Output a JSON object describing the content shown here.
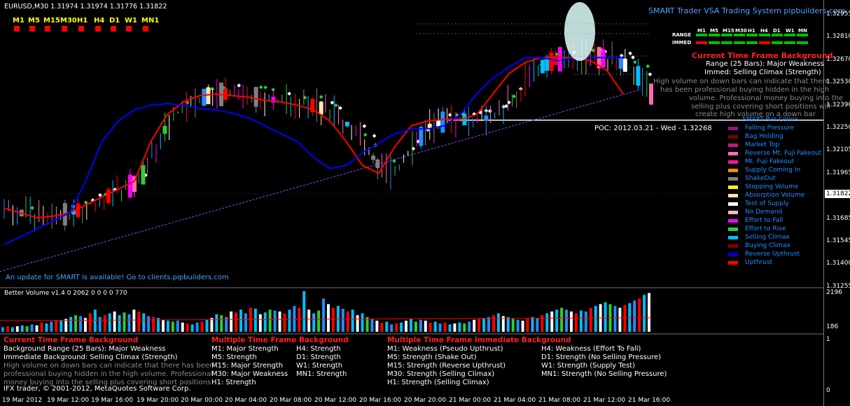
{
  "header": {
    "symbol_line": "EURUSD,M30  1.31974 1.31974 1.31776 1.31822",
    "brand": "SMART Trader VSA Trading System pipbuilders.com"
  },
  "timeframes": [
    "M1",
    "M5",
    "M15",
    "M30",
    "H1",
    "H4",
    "D1",
    "W1",
    "MN1"
  ],
  "mtf_grid": {
    "headers": [
      "M1",
      "M5",
      "M15",
      "M30",
      "H1",
      "H4",
      "D1",
      "W1",
      "MN"
    ],
    "rows": [
      {
        "label": "RANGE",
        "colors": [
          "#00c000",
          "#00c000",
          "#00c000",
          "#00c000",
          "#00c000",
          "#00c000",
          "#00c000",
          "#00c000",
          "#00c000"
        ]
      },
      {
        "label": "IMMED",
        "colors": [
          "#ff0000",
          "#00c000",
          "#00c000",
          "#00c000",
          "#00c000",
          "#ff0000",
          "#00c000",
          "#00c000",
          "#00c000"
        ]
      }
    ]
  },
  "right_panel": {
    "title": "Current Time Frame Background",
    "range": "Range (25 Bars): Major Weakness",
    "immed": "Immed: Selling Climax (Strength)",
    "desc": [
      "High volume on down bars can indicate that there",
      "has been professional buying hidden in the high",
      "volume. Professional money buying into the",
      "selling plus covering short positions will",
      "create high volume on a down bar"
    ]
  },
  "poc_text": "POC: 2012.03.21 - Wed - 1.32268",
  "bar_colors_title": "SMART Bar Colors",
  "bar_colors": [
    {
      "label": "Falling Pressure",
      "color": "#8b1a8b"
    },
    {
      "label": "Bag Holding",
      "color": "#7a0000"
    },
    {
      "label": "Market Top",
      "color": "#c71585"
    },
    {
      "label": "Reverse Mt. Fuji Fakeout",
      "color": "#ff69b4"
    },
    {
      "label": "Mt. Fuji Fakeout",
      "color": "#ff1493"
    },
    {
      "label": "Supply Coming In",
      "color": "#ff8c00"
    },
    {
      "label": "ShakeOut",
      "color": "#808080"
    },
    {
      "label": "Stopping Volume",
      "color": "#ffff00"
    },
    {
      "label": "Absorption Volume",
      "color": "#ffe4b5"
    },
    {
      "label": "Test of Supply",
      "color": "#ffffff"
    },
    {
      "label": "No Demand",
      "color": "#ffb6c1"
    },
    {
      "label": "Effort to Fall",
      "color": "#ff00ff"
    },
    {
      "label": "Effort to Rise",
      "color": "#32cd32"
    },
    {
      "label": "Selling Climax",
      "color": "#00bfff"
    },
    {
      "label": "Buying Climax",
      "color": "#800000"
    },
    {
      "label": "Reverse Upthrust",
      "color": "#0000cd"
    },
    {
      "label": "Upthrust",
      "color": "#ff0000"
    }
  ],
  "update_notice": "An update for SMART is available! Go to clients.pipbuilders.com",
  "volume_label": "Better Volume v1.4 0 2062 0 0 0 0 770",
  "volume_axis": [
    "2196",
    "186"
  ],
  "bottom": {
    "cur_title": "Current Time Frame Background",
    "cur_lines": [
      "Background Range (25 Bars): Major Weakness",
      "Immediate Background: Selling Climax (Strength)"
    ],
    "cur_desc": [
      "High volume on down bars can indicate that there has been",
      "professional buying hidden in the high volume. Professional",
      "money buying into the selling plus covering short positions"
    ],
    "copyright": "IFX trader, © 2001-2012, MetaQuotes Software Corp.",
    "mtf_bg_title": "Multiple Time Frame Background",
    "mtf_bg_col1": [
      "M1:  Major Strength",
      "M5:  Strength",
      "M15: Major Strength",
      "M30: Major Weakness",
      "H1:  Strength"
    ],
    "mtf_bg_col2": [
      "H4:  Strength",
      "D1:  Strength",
      "W1:   Strength",
      "MN1: Strength"
    ],
    "mtf_im_title": "Multiple Time Frame Immediate Background",
    "mtf_im_col1": [
      "M1:  Weakness (Pseudo Upthrust)",
      "M5:  Strength (Shake Out)",
      "M15: Strength (Reverse Upthrust)",
      "M30: Strength (Selling Climax)",
      "H1:  Strength (Selling Climax)"
    ],
    "mtf_im_col2": [
      "H4:  Weakness (Effort To Fall)",
      "D1:  Strength (No Selling Pressure)",
      "W1:   Strength (Supply Test)",
      "MN1: Strength (No Selling Pressure)"
    ]
  },
  "price_axis": [
    "1.32955",
    "1.32810",
    "1.32670",
    "1.32530",
    "1.32390",
    "1.32250",
    "1.32105",
    "1.31965",
    "1.31822",
    "1.31685",
    "1.31545",
    "1.31400",
    "1.31255"
  ],
  "time_axis": [
    "19 Mar 2012",
    "19 Mar 12:00",
    "19 Mar 16:00",
    "19 Mar 20:00",
    "20 Mar 00:00",
    "20 Mar 04:00",
    "20 Mar 08:00",
    "20 Mar 12:00",
    "20 Mar 16:00",
    "20 Mar 20:00",
    "21 Mar 00:00",
    "21 Mar 04:00",
    "21 Mar 08:00",
    "21 Mar 12:00",
    "21 Mar 16:00"
  ],
  "chart_data": {
    "type": "line",
    "title": "EURUSD,M30",
    "ylim": [
      1.31255,
      1.32955
    ],
    "current_price": 1.31822,
    "series": [
      {
        "name": "",
        "color": "#ff0000",
        "values": [
          1.3173,
          1.317,
          1.3167,
          1.3168,
          1.317,
          1.3175,
          1.318,
          1.3185,
          1.319,
          1.3215,
          1.3232,
          1.324,
          1.3244,
          1.3245,
          1.3244,
          1.3243,
          1.3241,
          1.324,
          1.3238,
          1.3235,
          1.3228,
          1.3215,
          1.32,
          1.3195,
          1.3212,
          1.3225,
          1.3228,
          1.3229,
          1.3229,
          1.3232,
          1.3245,
          1.3258,
          1.3265,
          1.3268,
          1.3268,
          1.3268,
          1.3266,
          1.326,
          1.3245
        ]
      },
      {
        "name": "",
        "color": "#0000ff",
        "values": [
          1.315,
          1.3155,
          1.316,
          1.3165,
          1.317,
          1.319,
          1.3215,
          1.3228,
          1.3235,
          1.3238,
          1.3239,
          1.3238,
          1.3236,
          1.3235,
          1.3233,
          1.323,
          1.3225,
          1.322,
          1.3215,
          1.3205,
          1.3198,
          1.32,
          1.3208,
          1.3214,
          1.322,
          1.3223,
          1.3223,
          1.3225,
          1.3232,
          1.3245,
          1.3255,
          1.3262,
          1.3268,
          1.3268,
          1.3266,
          1.3268,
          1.3268,
          1.3268,
          1.3268
        ]
      }
    ],
    "volume": {
      "values": [
        5,
        6,
        5,
        6,
        7,
        6,
        8,
        7,
        10,
        9,
        11,
        13,
        12,
        14,
        16,
        18,
        17,
        15,
        20,
        24,
        16,
        18,
        20,
        22,
        18,
        21,
        19,
        24,
        22,
        20,
        17,
        16,
        15,
        13,
        12,
        11,
        12,
        10,
        9,
        8,
        10,
        11,
        13,
        15,
        19,
        18,
        16,
        22,
        21,
        24,
        20,
        26,
        25,
        19,
        21,
        24,
        23,
        22,
        20,
        24,
        28,
        26,
        44,
        24,
        20,
        23,
        36,
        30,
        26,
        28,
        25,
        22,
        24,
        18,
        20,
        16,
        14,
        12,
        10,
        11,
        8,
        9,
        10,
        12,
        14,
        11,
        13,
        12,
        10,
        11,
        9,
        10,
        8,
        9,
        10,
        9,
        11,
        13,
        14,
        15,
        16,
        18,
        20,
        17,
        16,
        14,
        13,
        12,
        14,
        16,
        15,
        18,
        20,
        22,
        24,
        26,
        24,
        22,
        20,
        23,
        22,
        26,
        28,
        30,
        32,
        30,
        28,
        26,
        29,
        31,
        34,
        36,
        40,
        42
      ],
      "colors": [
        "#1e90ff",
        "#ff0000",
        "#00bfff",
        "#ffffff",
        "#00bfff",
        "#32cd32",
        "#1e90ff",
        "#ffffff",
        "#ff0000",
        "#00bfff"
      ]
    }
  }
}
